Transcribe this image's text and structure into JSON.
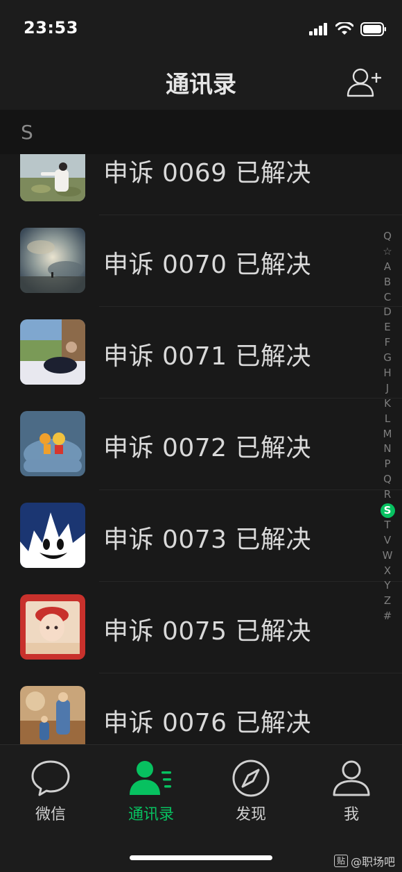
{
  "status": {
    "time": "23:53"
  },
  "header": {
    "title": "通讯录"
  },
  "section": {
    "letter": "S"
  },
  "contacts": [
    {
      "label": "申诉 0069 已解决"
    },
    {
      "label": "申诉 0070 已解决"
    },
    {
      "label": "申诉 0071 已解决"
    },
    {
      "label": "申诉 0072 已解决"
    },
    {
      "label": "申诉 0073 已解决"
    },
    {
      "label": "申诉 0075 已解决"
    },
    {
      "label": "申诉 0076 已解决"
    }
  ],
  "index_letters": [
    "Q",
    "☆",
    "A",
    "B",
    "C",
    "D",
    "E",
    "F",
    "G",
    "H",
    "J",
    "K",
    "L",
    "M",
    "N",
    "P",
    "Q",
    "R",
    "S",
    "T",
    "V",
    "W",
    "X",
    "Y",
    "Z",
    "#"
  ],
  "index_active": "S",
  "tabs": [
    {
      "label": "微信",
      "icon": "chat-bubble-icon"
    },
    {
      "label": "通讯录",
      "icon": "contacts-icon"
    },
    {
      "label": "发现",
      "icon": "compass-icon"
    },
    {
      "label": "我",
      "icon": "person-icon"
    }
  ],
  "colors": {
    "accent": "#07c160",
    "background": "#111111",
    "bar": "#1c1c1c"
  },
  "watermark": {
    "badge": "贴",
    "text": "@职场吧"
  }
}
